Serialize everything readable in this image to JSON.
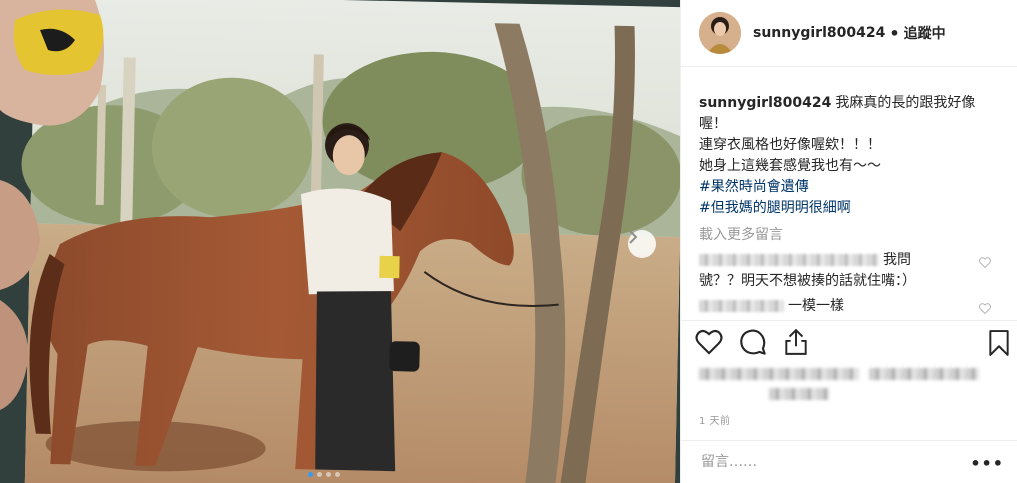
{
  "post": {
    "username": "sunnygirl800424",
    "separator": "•",
    "follow_label": "追蹤中",
    "caption_lines": [
      "我麻真的長的跟我好像喔！",
      "連穿衣風格也好像喔欸！！！",
      "她身上這幾套感覺我也有～～"
    ],
    "hashtags": [
      "#果然時尚會遺傳",
      "#但我媽的腿明明很細啊"
    ],
    "load_more": "載入更多留言",
    "comments": [
      {
        "text_line1": "我問",
        "text_line2": "號？？明天不想被揍的話就住嘴：）"
      },
      {
        "text": "一模一樣"
      }
    ],
    "time_ago": "1 天前",
    "comment_placeholder": "留言……",
    "more_label": "•••"
  },
  "icons": {
    "like": "heart-icon",
    "comment": "comment-bubble-icon",
    "share": "share-icon",
    "save": "bookmark-icon",
    "next": "chevron-right-icon",
    "options": "more-options-icon"
  },
  "carousel": {
    "count": 4,
    "active_index": 0
  },
  "colors": {
    "accent": "#3897f0",
    "hashtag": "#003569",
    "muted": "#999999"
  }
}
